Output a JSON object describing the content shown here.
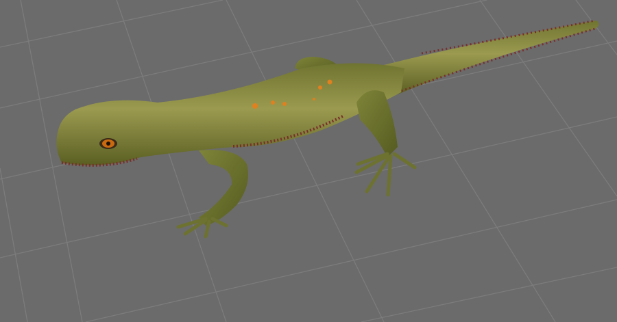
{
  "scene": {
    "subject": "lizard-model",
    "colors": {
      "background": "#6b6b6b",
      "grid_line": "#7b7b7b",
      "skin_light": "#9a9a4a",
      "skin_dark": "#5d6426",
      "spines": "#7a2e2a",
      "spots": "#e0801f",
      "eye": "#c96a10"
    }
  }
}
